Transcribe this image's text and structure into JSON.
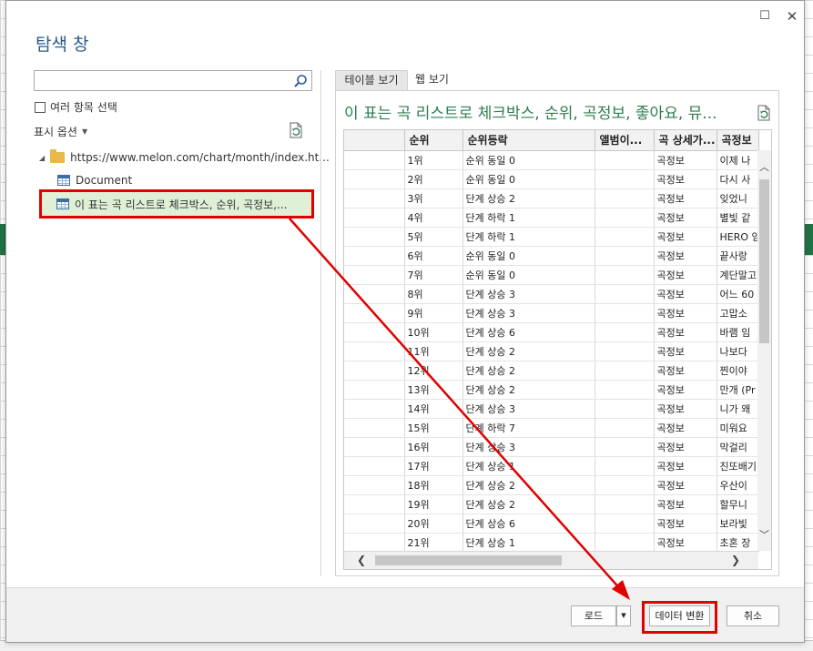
{
  "dialog": {
    "title": "탐색 창",
    "maximize_glyph": "☐",
    "close_glyph": "✕"
  },
  "left_pane": {
    "search": {
      "value": "",
      "placeholder": ""
    },
    "multi_select_label": "여러 항목 선택",
    "display_options_label": "표시 옵션",
    "tree": {
      "root_label": "https://www.melon.com/chart/month/index.ht...",
      "document_label": "Document",
      "table_label": "이 표는 곡 리스트로 체크박스, 순위, 곡정보,..."
    }
  },
  "right_pane": {
    "tabs": {
      "table_view": "테이블 보기",
      "web_view": "웹 보기"
    },
    "preview_title": "이 표는 곡 리스트로 체크박스, 순위, 곡정보, 좋아요, 뮤...",
    "columns": [
      "",
      "순위",
      "순위등락",
      "앨범이...",
      "곡 상세가...",
      "곡정보"
    ],
    "rows": [
      [
        "",
        "1위",
        "순위 동일 0",
        "",
        "곡정보",
        "이제 나"
      ],
      [
        "",
        "2위",
        "순위 동일 0",
        "",
        "곡정보",
        "다시 사"
      ],
      [
        "",
        "3위",
        "단계 상승 2",
        "",
        "곡정보",
        "잊었니"
      ],
      [
        "",
        "4위",
        "단계 하락 1",
        "",
        "곡정보",
        "별빛 같"
      ],
      [
        "",
        "5위",
        "단계 하락 1",
        "",
        "곡정보",
        "HERO 임"
      ],
      [
        "",
        "6위",
        "순위 동일 0",
        "",
        "곡정보",
        "끝사랑"
      ],
      [
        "",
        "7위",
        "순위 동일 0",
        "",
        "곡정보",
        "계단말고"
      ],
      [
        "",
        "8위",
        "단계 상승 3",
        "",
        "곡정보",
        "어느 60"
      ],
      [
        "",
        "9위",
        "단계 상승 3",
        "",
        "곡정보",
        "고맙소"
      ],
      [
        "",
        "10위",
        "단계 상승 6",
        "",
        "곡정보",
        "바램 임"
      ],
      [
        "",
        "11위",
        "단계 상승 2",
        "",
        "곡정보",
        "나보다"
      ],
      [
        "",
        "12위",
        "단계 상승 2",
        "",
        "곡정보",
        "찐이야"
      ],
      [
        "",
        "13위",
        "단계 상승 2",
        "",
        "곡정보",
        "만개 (Pr"
      ],
      [
        "",
        "14위",
        "단계 상승 3",
        "",
        "곡정보",
        "니가 왜"
      ],
      [
        "",
        "15위",
        "단계 하락 7",
        "",
        "곡정보",
        "미워요"
      ],
      [
        "",
        "16위",
        "단계 상승 3",
        "",
        "곡정보",
        "막걸리"
      ],
      [
        "",
        "17위",
        "단계 상승 1",
        "",
        "곡정보",
        "진또배기"
      ],
      [
        "",
        "18위",
        "단계 상승 2",
        "",
        "곡정보",
        "우산이"
      ],
      [
        "",
        "19위",
        "단계 상승 2",
        "",
        "곡정보",
        "할무니"
      ],
      [
        "",
        "20위",
        "단계 상승 6",
        "",
        "곡정보",
        "보라빛"
      ],
      [
        "",
        "21위",
        "단계 상승 1",
        "",
        "곡정보",
        "초혼 장"
      ]
    ]
  },
  "footer": {
    "load_label": "로드",
    "transform_label": "데이터 변환",
    "cancel_label": "취소"
  },
  "colors": {
    "annotation_red": "#e00000",
    "title_blue": "#2a5b8c",
    "preview_green": "#2e7d4f",
    "selection_green": "#dff0d6"
  }
}
